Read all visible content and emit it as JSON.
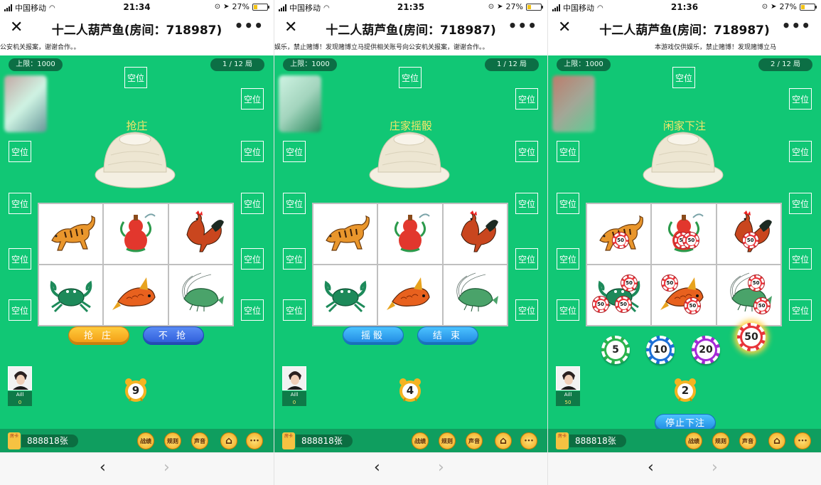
{
  "colors": {
    "table_green": "#11c775",
    "dark_green": "#0c6f45",
    "status_yellow": "#f8e66a",
    "chip_red": "#e8343a"
  },
  "panels": [
    {
      "status": {
        "carrier": "中国移动",
        "time": "21:34",
        "battery": "27%",
        "battery_level": 0.27
      },
      "nav": {
        "close": "✕",
        "title": "十二人葫芦鱼(房间：718987)",
        "more": "•••"
      },
      "marquee": "公安机关报案，谢谢合作。。",
      "limit": "上限：1000",
      "round": "1 / 12 局",
      "seat_label": "空位",
      "phase": "抢庄",
      "buttons": [
        {
          "label": "抢 庄",
          "style": "orange"
        },
        {
          "label": "不 抢",
          "style": "blue"
        }
      ],
      "player": {
        "name": "Aill",
        "score": "0"
      },
      "timer": "9",
      "bet_chips": [],
      "board_chips": [],
      "stop_button": "",
      "balance": "888818张",
      "card_label": "房卡",
      "tools": [
        "战绩",
        "规则",
        "声音",
        "home-icon",
        "chat-icon"
      ],
      "browser": {
        "back": "‹",
        "forward": "›"
      }
    },
    {
      "status": {
        "carrier": "中国移动",
        "time": "21:35",
        "battery": "27%",
        "battery_level": 0.27
      },
      "nav": {
        "close": "✕",
        "title": "十二人葫芦鱼(房间：718987)",
        "more": "•••"
      },
      "marquee": "娱乐，禁止赌博！发现赌博立马提供相关账号向公安机关报案，谢谢合作。。",
      "limit": "上限：1000",
      "round": "1 / 12 局",
      "seat_label": "空位",
      "phase": "庄家摇骰",
      "buttons": [
        {
          "label": "摇骰",
          "style": "cyan"
        },
        {
          "label": "结 束",
          "style": "cyan"
        }
      ],
      "player": {
        "name": "Aill",
        "score": "0"
      },
      "timer": "4",
      "bet_chips": [],
      "board_chips": [],
      "stop_button": "",
      "balance": "888818张",
      "card_label": "房卡",
      "tools": [
        "战绩",
        "规则",
        "声音",
        "home-icon",
        "chat-icon"
      ],
      "browser": {
        "back": "‹",
        "forward": "›"
      }
    },
    {
      "status": {
        "carrier": "中国移动",
        "time": "21:36",
        "battery": "27%",
        "battery_level": 0.27
      },
      "nav": {
        "close": "✕",
        "title": "十二人葫芦鱼(房间：718987)",
        "more": "•••"
      },
      "marquee": "本游戏仅供娱乐，禁止赌博！发现赌博立马",
      "limit": "上限：1000",
      "round": "2 / 12 局",
      "seat_label": "空位",
      "phase": "闲家下注",
      "buttons": [],
      "player": {
        "name": "Aill",
        "score": "50"
      },
      "timer": "2",
      "bet_chips": [
        {
          "value": "5",
          "color": "#2bb24c"
        },
        {
          "value": "10",
          "color": "#1c6fd6"
        },
        {
          "value": "20",
          "color": "#a42ad6"
        },
        {
          "value": "50",
          "color": "#e8343a"
        }
      ],
      "board_chips": [
        {
          "cell": 0,
          "value": "50"
        },
        {
          "cell": 1,
          "value": "50"
        },
        {
          "cell": 1,
          "value": "50"
        },
        {
          "cell": 2,
          "value": "50"
        },
        {
          "cell": 3,
          "value": "50"
        },
        {
          "cell": 3,
          "value": "50"
        },
        {
          "cell": 3,
          "value": "50"
        },
        {
          "cell": 4,
          "value": "50"
        },
        {
          "cell": 4,
          "value": "50"
        },
        {
          "cell": 5,
          "value": "50"
        },
        {
          "cell": 5,
          "value": "50"
        }
      ],
      "stop_button": "停止下注",
      "balance": "888818张",
      "card_label": "房卡",
      "tools": [
        "战绩",
        "规则",
        "声音",
        "home-icon",
        "chat-icon"
      ],
      "browser": {
        "back": "‹",
        "forward": "›"
      }
    }
  ],
  "board_icons": [
    "tiger-icon",
    "gourd-icon",
    "rooster-icon",
    "crab-icon",
    "fish-icon",
    "shrimp-icon"
  ]
}
